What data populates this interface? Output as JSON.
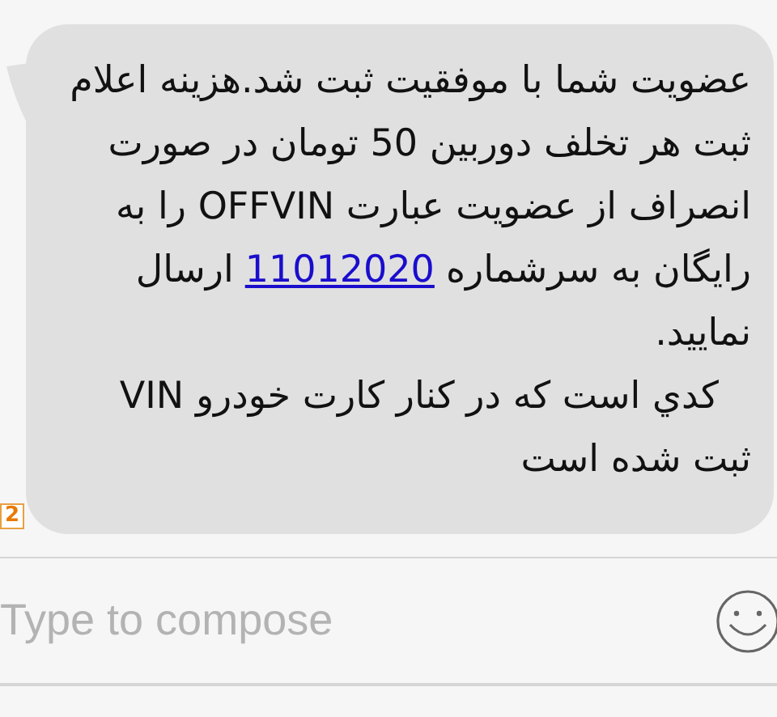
{
  "message": {
    "lines": [
      {
        "text": "عضویت شما با موفقیت ثبت شد.هزینه اعلام"
      },
      {
        "text": "ثبت هر تخلف دوربین 50 تومان در صورت"
      },
      {
        "text": "انصراف از عضویت عبارت OFFVIN را به"
      },
      {
        "text": "رایگان به سرشماره",
        "link": "11012020",
        "after": "ارسال"
      },
      {
        "text": "نمایید."
      },
      {
        "text": "کدي است که در کنار کارت خودرو VIN"
      },
      {
        "text": "ثبت شده است"
      }
    ],
    "sim_badge": "2"
  },
  "compose": {
    "placeholder": "Type to compose"
  }
}
